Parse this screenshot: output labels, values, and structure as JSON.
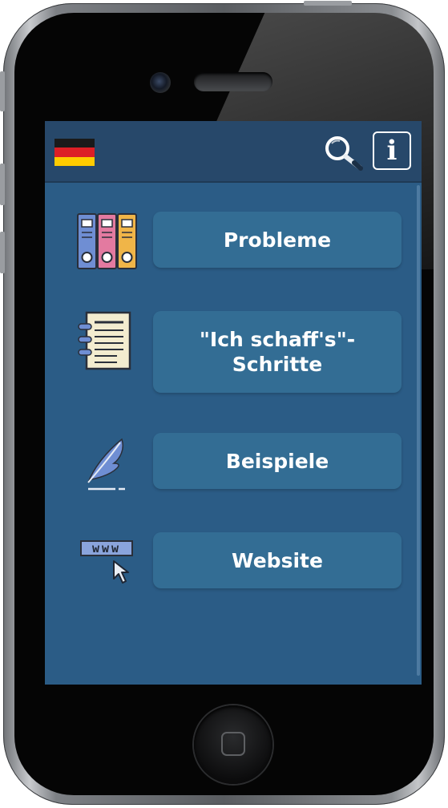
{
  "header": {
    "flag_icon": "germany-flag-icon",
    "flag_colors": [
      "#1a1a1a",
      "#dd1f26",
      "#ffcc00"
    ],
    "search_icon": "magnifier-icon",
    "info_label": "i"
  },
  "menu": [
    {
      "icon": "binders-icon",
      "label": "Probleme"
    },
    {
      "icon": "document-list-icon",
      "label": "\"Ich schaff's\"- Schritte"
    },
    {
      "icon": "feather-quill-icon",
      "label": "Beispiele"
    },
    {
      "icon": "www-cursor-icon",
      "label": "Website",
      "icon_text": "www"
    }
  ],
  "colors": {
    "screen_background": "#2b5c86",
    "topbar_background": "#27486a",
    "button_background": "#336d94",
    "button_text": "#ffffff"
  }
}
